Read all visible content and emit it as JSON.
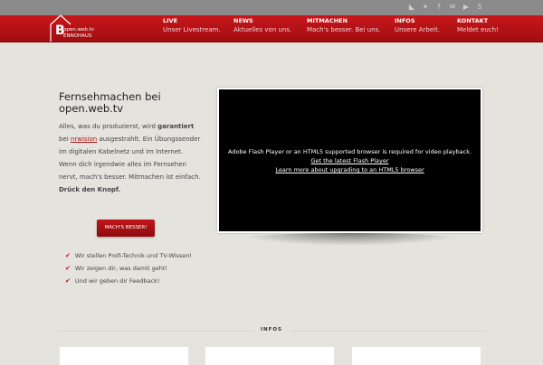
{
  "social_icons": [
    "rss-icon",
    "twitter-icon",
    "facebook-icon",
    "mail-icon",
    "youtube-icon",
    "skype-icon"
  ],
  "logo": {
    "letter": "B",
    "line1": "open.web.tv",
    "line2": "ENNOHAUS"
  },
  "nav": [
    {
      "title": "LIVE",
      "subtitle": "Unser Livestream."
    },
    {
      "title": "NEWS",
      "subtitle": "Aktuelles von uns."
    },
    {
      "title": "MITMACHEN",
      "subtitle": "Mach's besser. Bei uns."
    },
    {
      "title": "INFOS",
      "subtitle": "Unsere Arbeit."
    },
    {
      "title": "KONTAKT",
      "subtitle": "Meldet euch!"
    }
  ],
  "intro": {
    "heading": "Fernsehmachen bei open.web.tv",
    "p1_a": "Alles, was du produzierst, wird ",
    "p1_bold": "garantiert",
    "p1_b": " bei ",
    "p1_link": "nrwision",
    "p1_c": " ausgestrahlt. Ein Übungssender im digitalen Kabelnetz und im Internet.",
    "p2_a": "Wenn dich irgendwie alles im Fernsehen nervt, mach's besser. Mitmachen ist einfach. ",
    "p2_bold": "Drück den Knopf.",
    "button": "MACH'S BESSER!"
  },
  "checks": [
    "Wir stellen Profi-Technik und TV-Wissen!",
    "Wir zeigen dir, was damit geht!",
    "Und wir geben dir Feedback!"
  ],
  "video": {
    "message": "Adobe Flash Player or an HTML5 supported browser is required for video playback.",
    "link1": "Get the latest Flash Player",
    "link2": "Learn more about upgrading to an HTML5 browser"
  },
  "section_title": "INFOS"
}
